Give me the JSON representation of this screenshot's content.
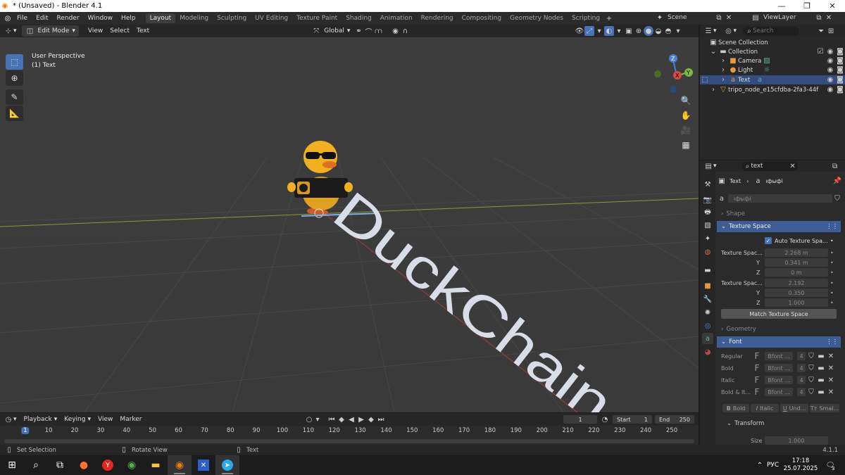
{
  "window": {
    "title": "* (Unsaved) - Blender 4.1"
  },
  "menubar": {
    "menus": [
      "File",
      "Edit",
      "Render",
      "Window",
      "Help"
    ],
    "workspaces": [
      "Layout",
      "Modeling",
      "Sculpting",
      "UV Editing",
      "Texture Paint",
      "Shading",
      "Animation",
      "Rendering",
      "Compositing",
      "Geometry Nodes",
      "Scripting"
    ],
    "active_workspace": "Layout",
    "scene": "Scene",
    "view_layer": "ViewLayer"
  },
  "viewport_header": {
    "mode": "Edit Mode",
    "menus": [
      "View",
      "Select",
      "Text"
    ],
    "orientation": "Global"
  },
  "viewport": {
    "perspective": "User Perspective",
    "object_label": "(1) Text",
    "text_object": "DuckChain",
    "gizmo": {
      "z": "Z",
      "x": "X",
      "y": "Y"
    }
  },
  "outliner": {
    "search_placeholder": "Search",
    "root": "Scene Collection",
    "items": [
      {
        "name": "Collection"
      },
      {
        "name": "Camera"
      },
      {
        "name": "Light"
      },
      {
        "name": "Text"
      },
      {
        "name": "tripo_node_e15cfdba-2fa3-44f"
      }
    ]
  },
  "properties": {
    "search_value": "text",
    "breadcrumb_object": "Text",
    "breadcrumb_data": "ıфыфі",
    "data_name": "ıфыфі",
    "panels": {
      "shape": "Shape",
      "texture_space": "Texture Space",
      "geometry": "Geometry",
      "font": "Font",
      "transform": "Transform"
    },
    "auto_texture_space": "Auto Texture Spa...",
    "texture_space_location_label": "Texture Spac...",
    "location": {
      "x": "2.268 m",
      "y": "0.341 m",
      "z": "0 m"
    },
    "texture_space_size_label": "Texture Spac...",
    "size": {
      "x": "2.192",
      "y": "0.350",
      "z": "1.000"
    },
    "axis_labels": {
      "y": "Y",
      "z": "Z"
    },
    "match_button": "Match Texture Space",
    "fonts": [
      {
        "label": "Regular",
        "value": "Bfont ...",
        "users": "4"
      },
      {
        "label": "Bold",
        "value": "Bfont ...",
        "users": "4"
      },
      {
        "label": "Italic",
        "value": "Bfont ...",
        "users": "4"
      },
      {
        "label": "Bold & It...",
        "value": "Bfont ...",
        "users": "4"
      }
    ],
    "style_buttons": [
      "Bold",
      "Italic",
      "Und...",
      "Smal..."
    ],
    "transform_size_label": "Size",
    "transform_size_value": "1.000"
  },
  "timeline": {
    "menus": [
      "Playback",
      "Keying",
      "View",
      "Marker"
    ],
    "current_frame": "1",
    "start_label": "Start",
    "start": "1",
    "end_label": "End",
    "end": "250",
    "ticks": [
      "1",
      "10",
      "20",
      "30",
      "40",
      "50",
      "60",
      "70",
      "80",
      "90",
      "100",
      "110",
      "120",
      "130",
      "140",
      "150",
      "160",
      "170",
      "180",
      "190",
      "200",
      "210",
      "220",
      "230",
      "240",
      "250"
    ]
  },
  "statusbar": {
    "left": "Set Selection",
    "middle": "Rotate View",
    "right": "Text",
    "version": "4.1.1"
  },
  "taskbar": {
    "language": "РУС",
    "time": "17:18",
    "date": "25.07.2025",
    "notifications": "3"
  }
}
